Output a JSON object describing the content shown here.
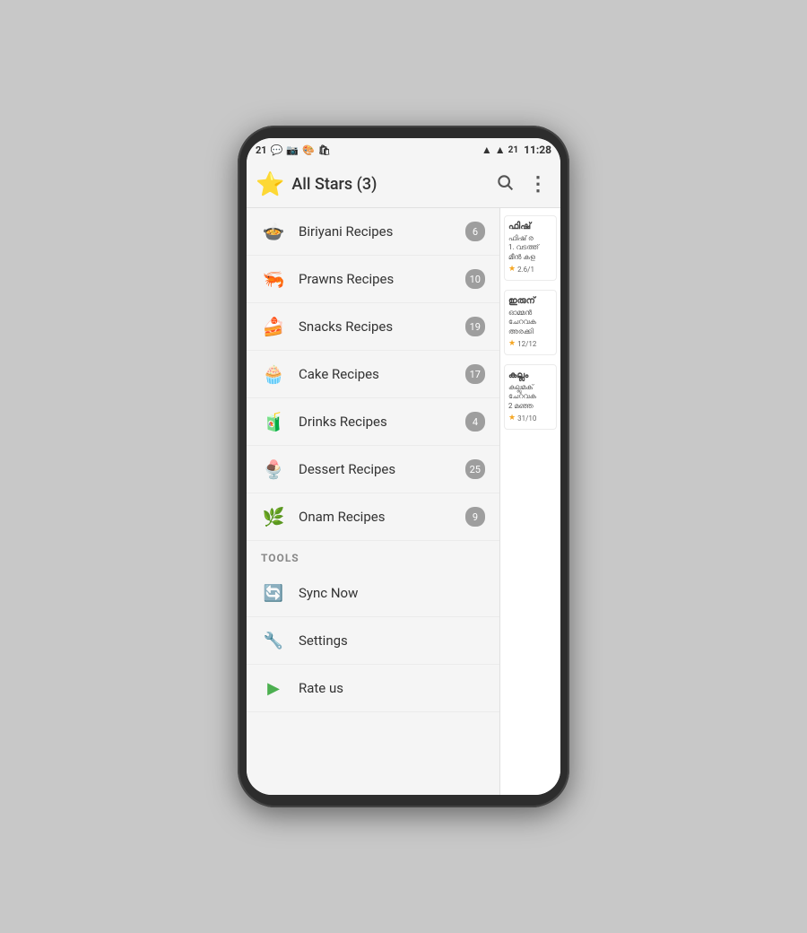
{
  "status_bar": {
    "left_icons": "21 📱 📷 🎨 🛍",
    "wifi": "📶",
    "signal": "📶",
    "battery_num": "21",
    "time": "11:28"
  },
  "app_bar": {
    "title": "All Stars (3)",
    "star_icon": "⭐",
    "search_icon": "🔍",
    "more_icon": "⋮"
  },
  "menu_items": [
    {
      "id": "biriyani",
      "label": "Biriyani Recipes",
      "icon": "🍲",
      "badge": "6"
    },
    {
      "id": "prawns",
      "label": "Prawns Recipes",
      "icon": "🦐",
      "badge": "10"
    },
    {
      "id": "snacks",
      "label": "Snacks Recipes",
      "icon": "🍰",
      "badge": "19"
    },
    {
      "id": "cake",
      "label": "Cake Recipes",
      "icon": "🧁",
      "badge": "17"
    },
    {
      "id": "drinks",
      "label": "Drinks Recipes",
      "icon": "🧃",
      "badge": "4"
    },
    {
      "id": "dessert",
      "label": "Dessert Recipes",
      "icon": "🍨",
      "badge": "25"
    },
    {
      "id": "onam",
      "label": "Onam Recipes",
      "icon": "🌿",
      "badge": "9"
    }
  ],
  "tools_header": "TOOLS",
  "tools_items": [
    {
      "id": "sync",
      "label": "Sync Now",
      "icon": "🔄"
    },
    {
      "id": "settings",
      "label": "Settings",
      "icon": "🔧"
    },
    {
      "id": "rate",
      "label": "Rate us",
      "icon": "▶"
    }
  ],
  "side_cards": [
    {
      "title": "ഫിഷ്",
      "lines": [
        "ഫിഷ് ര",
        "1. വടത്ത്",
        "മീൻ കള"
      ],
      "rating": "2.6/1"
    },
    {
      "title": "ഇരുന്",
      "lines": [
        "ഓമ്മൻ",
        "ചേറവക",
        "അരക്കി"
      ],
      "rating": "12/12"
    },
    {
      "title": "കല്ലും",
      "lines": [
        "കല്ലുമക്",
        "ചേറവക",
        "2 മഞ്ഞ"
      ],
      "rating": "31/10"
    }
  ]
}
